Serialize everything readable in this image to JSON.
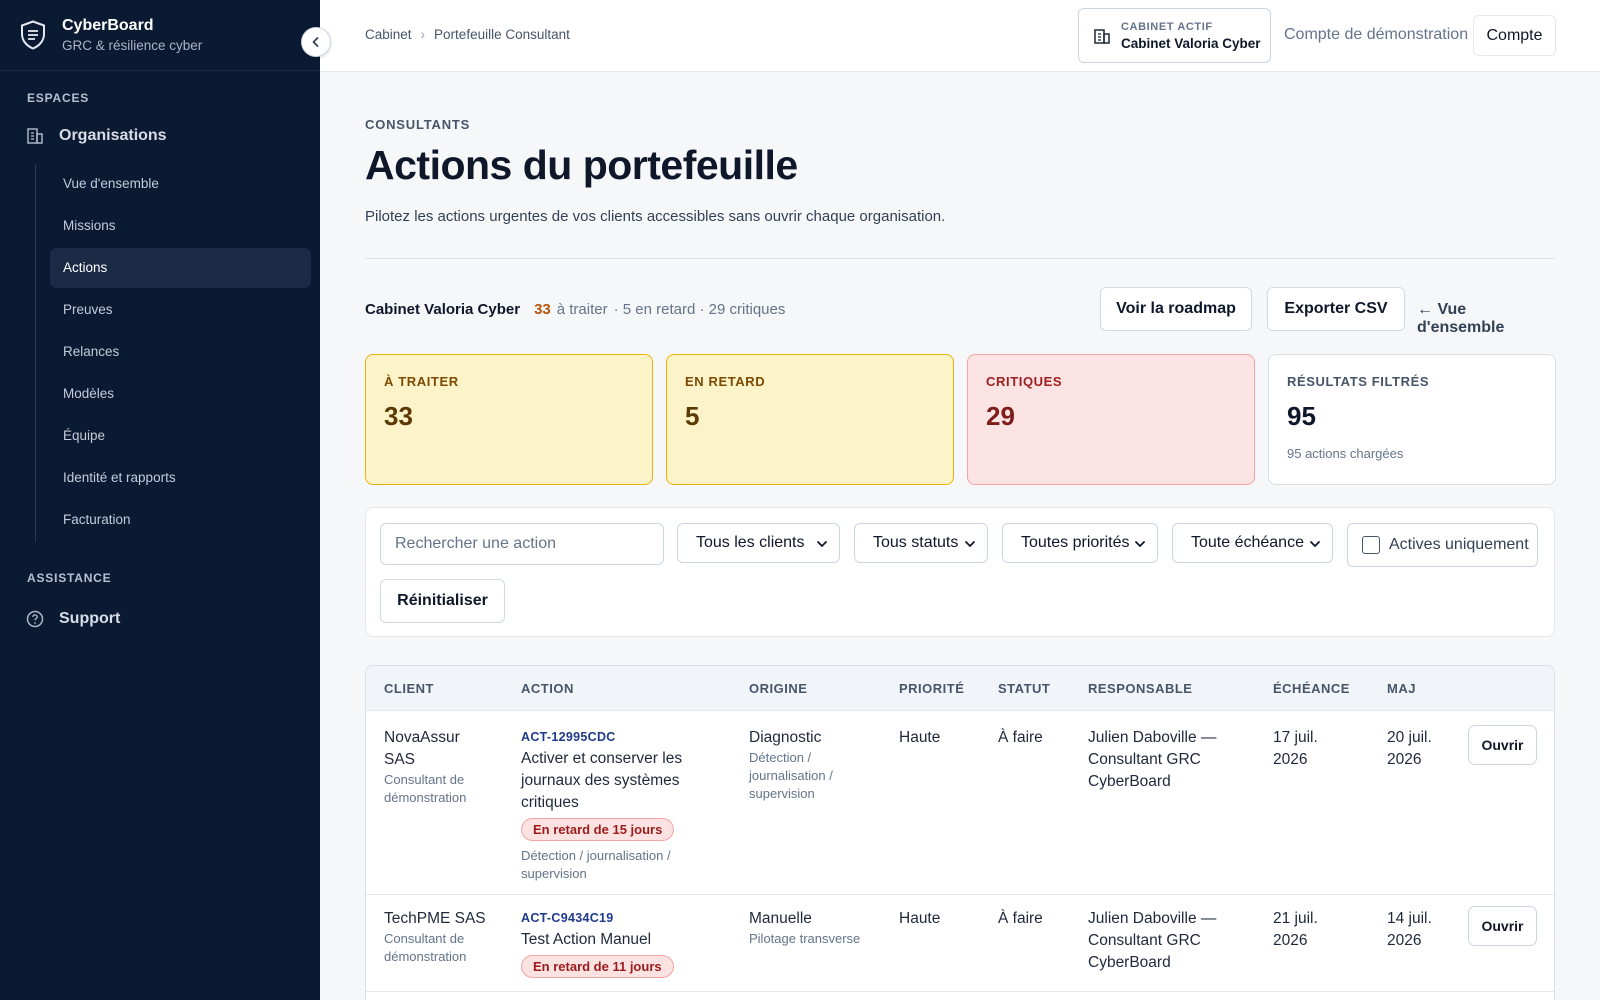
{
  "app": {
    "name": "CyberBoard",
    "tagline": "GRC & résilience cyber"
  },
  "sidebar": {
    "section_spaces": "ESPACES",
    "organisations_label": "Organisations",
    "items": [
      {
        "label": "Vue d'ensemble"
      },
      {
        "label": "Missions"
      },
      {
        "label": "Actions"
      },
      {
        "label": "Preuves"
      },
      {
        "label": "Relances"
      },
      {
        "label": "Modèles"
      },
      {
        "label": "Équipe"
      },
      {
        "label": "Identité et rapports"
      },
      {
        "label": "Facturation"
      }
    ],
    "active_item": "Actions",
    "section_assistance": "ASSISTANCE",
    "support_label": "Support"
  },
  "header": {
    "breadcrumb": [
      "Cabinet",
      "Portefeuille Consultant"
    ],
    "breadcrumb_sep": "›",
    "cabinet_label": "CABINET ACTIF",
    "cabinet_value": "Cabinet Valoria Cyber",
    "demo_account": "Compte de démonstration",
    "account_button": "Compte"
  },
  "page": {
    "eyebrow": "CONSULTANTS",
    "title": "Actions du portefeuille",
    "description": "Pilotez les actions urgentes de vos clients accessibles sans ouvrir chaque organisation."
  },
  "summary": {
    "org": "Cabinet Valoria Cyber",
    "count": "33",
    "to_treat": "à traiter",
    "rest": "· 5 en retard · 29 critiques",
    "roadmap_button": "Voir la roadmap",
    "export_button": "Exporter CSV",
    "back_link": "← Vue d'ensemble"
  },
  "kpis": [
    {
      "label": "À TRAITER",
      "value": "33"
    },
    {
      "label": "EN RETARD",
      "value": "5"
    },
    {
      "label": "CRITIQUES",
      "value": "29"
    },
    {
      "label": "RÉSULTATS FILTRÉS",
      "value": "95",
      "sub": "95 actions chargées"
    }
  ],
  "filters": {
    "search_placeholder": "Rechercher une action",
    "clients": "Tous les clients",
    "status": "Tous statuts",
    "priority": "Toutes priorités",
    "due": "Toute échéance",
    "active_only": "Actives uniquement",
    "reset": "Réinitialiser"
  },
  "table": {
    "columns": [
      "CLIENT",
      "ACTION",
      "ORIGINE",
      "PRIORITÉ",
      "STATUT",
      "RESPONSABLE",
      "ÉCHÉANCE",
      "MAJ"
    ],
    "open_label": "Ouvrir",
    "rows": [
      {
        "client": "NovaAssur SAS",
        "client_sub": "Consultant de démonstration",
        "action_id": "ACT-12995CDC",
        "action_title": "Activer et conserver les journaux des systèmes critiques",
        "badge": "En retard de 15 jours",
        "action_category": "Détection / journalisation / supervision",
        "origin": "Diagnostic",
        "origin_sub": "Détection / journalisation / supervision",
        "priority": "Haute",
        "status": "À faire",
        "owner": "Julien Daboville — Consultant GRC CyberBoard",
        "due": "17 juil. 2026",
        "updated": "20 juil. 2026"
      },
      {
        "client": "TechPME SAS",
        "client_sub": "Consultant de démonstration",
        "action_id": "ACT-C9434C19",
        "action_title": "Test Action Manuel",
        "badge": "En retard de 11 jours",
        "action_category": "",
        "origin": "Manuelle",
        "origin_sub": "Pilotage transverse",
        "priority": "Haute",
        "status": "À faire",
        "owner": "Julien Daboville — Consultant GRC CyberBoard",
        "due": "21 juil. 2026",
        "updated": "14 juil. 2026"
      }
    ]
  },
  "colors": {
    "sidebar_bg": "#0b1a33",
    "accent_warning": "#b45309",
    "yellow_card": "#fdf3c8",
    "red_card": "#fde4e4",
    "badge_red": "#9b1c1c"
  },
  "icons": [
    "shield-icon",
    "chevron-left-icon",
    "building-icon",
    "help-circle-icon",
    "chevron-down-icon",
    "checkbox-icon"
  ]
}
